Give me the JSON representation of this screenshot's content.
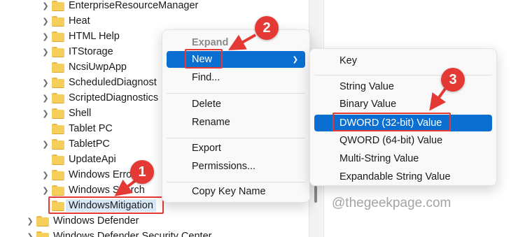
{
  "tree": {
    "items": [
      {
        "label": "EnterpriseResourceManager",
        "expandable": true
      },
      {
        "label": "Heat",
        "expandable": true
      },
      {
        "label": "HTML Help",
        "expandable": true
      },
      {
        "label": "ITStorage",
        "expandable": true
      },
      {
        "label": "NcsiUwpApp",
        "expandable": false
      },
      {
        "label": "ScheduledDiagnost",
        "expandable": true
      },
      {
        "label": "ScriptedDiagnostics",
        "expandable": true
      },
      {
        "label": "Shell",
        "expandable": true
      },
      {
        "label": "Tablet PC",
        "expandable": false
      },
      {
        "label": "TabletPC",
        "expandable": true
      },
      {
        "label": "UpdateApi",
        "expandable": false
      },
      {
        "label": "Windows Erro",
        "expandable": true
      },
      {
        "label": "Windows Search",
        "expandable": true
      },
      {
        "label": "WindowsMitigation",
        "expandable": false,
        "selected": true
      },
      {
        "label": "Windows Defender",
        "expandable": true
      },
      {
        "label": "Windows Defender Security Center",
        "expandable": true
      }
    ]
  },
  "context_menu": {
    "expand": "Expand",
    "new": "New",
    "find": "Find...",
    "delete": "Delete",
    "rename": "Rename",
    "export": "Export",
    "permissions": "Permissions...",
    "copy_key_name": "Copy Key Name"
  },
  "submenu": {
    "key": "Key",
    "string_value": "String Value",
    "binary_value": "Binary Value",
    "dword_value": "DWORD (32-bit) Value",
    "qword_value": "QWORD (64-bit) Value",
    "multi_string_value": "Multi-String Value",
    "expandable_string_value": "Expandable String Value"
  },
  "callouts": {
    "one": "1",
    "two": "2",
    "three": "3"
  },
  "watermark": "@thegeekpage.com",
  "colors": {
    "highlight": "#0a6fd1",
    "callout": "#e53935",
    "folder": "#f6cf5a"
  },
  "icons": {
    "expand": "chevron-right-icon",
    "folder": "folder-icon",
    "submenu": "submenu-arrow-icon"
  }
}
